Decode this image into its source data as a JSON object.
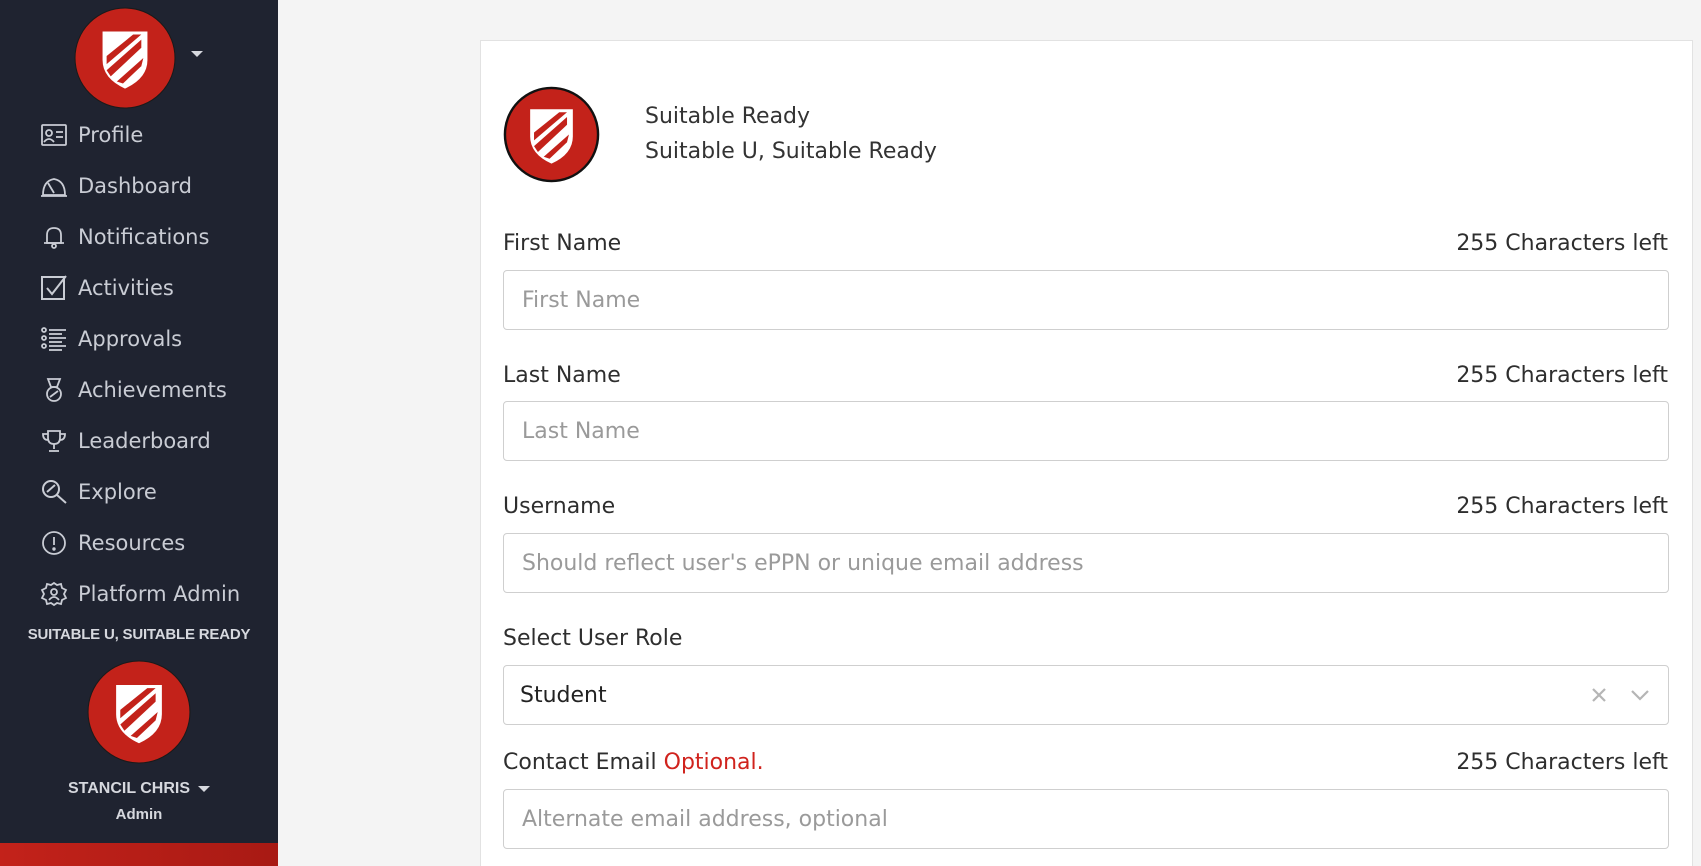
{
  "sidebar": {
    "logo_icon": "shield-logo",
    "nav": [
      {
        "label": "Profile",
        "icon": "profile-card-icon"
      },
      {
        "label": "Dashboard",
        "icon": "dashboard-gauge-icon"
      },
      {
        "label": "Notifications",
        "icon": "bell-icon"
      },
      {
        "label": "Activities",
        "icon": "checkbox-icon"
      },
      {
        "label": "Approvals",
        "icon": "checklist-icon"
      },
      {
        "label": "Achievements",
        "icon": "medal-icon"
      },
      {
        "label": "Leaderboard",
        "icon": "trophy-icon"
      },
      {
        "label": "Explore",
        "icon": "magnifier-icon"
      },
      {
        "label": "Resources",
        "icon": "info-circle-icon"
      },
      {
        "label": "Platform Admin",
        "icon": "gear-person-icon"
      }
    ],
    "org_label": "SUITABLE U, SUITABLE READY",
    "user_name": "STANCIL CHRIS",
    "user_role": "Admin"
  },
  "header": {
    "org_title": "Suitable Ready",
    "org_subtitle": "Suitable U, Suitable Ready"
  },
  "form": {
    "first_name": {
      "label": "First Name",
      "counter": "255 Characters left",
      "placeholder": "First Name",
      "value": ""
    },
    "last_name": {
      "label": "Last Name",
      "counter": "255 Characters left",
      "placeholder": "Last Name",
      "value": ""
    },
    "username": {
      "label": "Username",
      "counter": "255 Characters left",
      "placeholder": "Should reflect user's ePPN or unique email address",
      "value": ""
    },
    "role": {
      "label": "Select User Role",
      "value": "Student"
    },
    "contact_email": {
      "label": "Contact Email",
      "optional": "Optional.",
      "counter": "255 Characters left",
      "placeholder": "Alternate email address, optional",
      "value": ""
    }
  },
  "colors": {
    "sidebar_bg": "#1f2330",
    "brand_red": "#c3221a",
    "optional_red": "#d0231d"
  }
}
